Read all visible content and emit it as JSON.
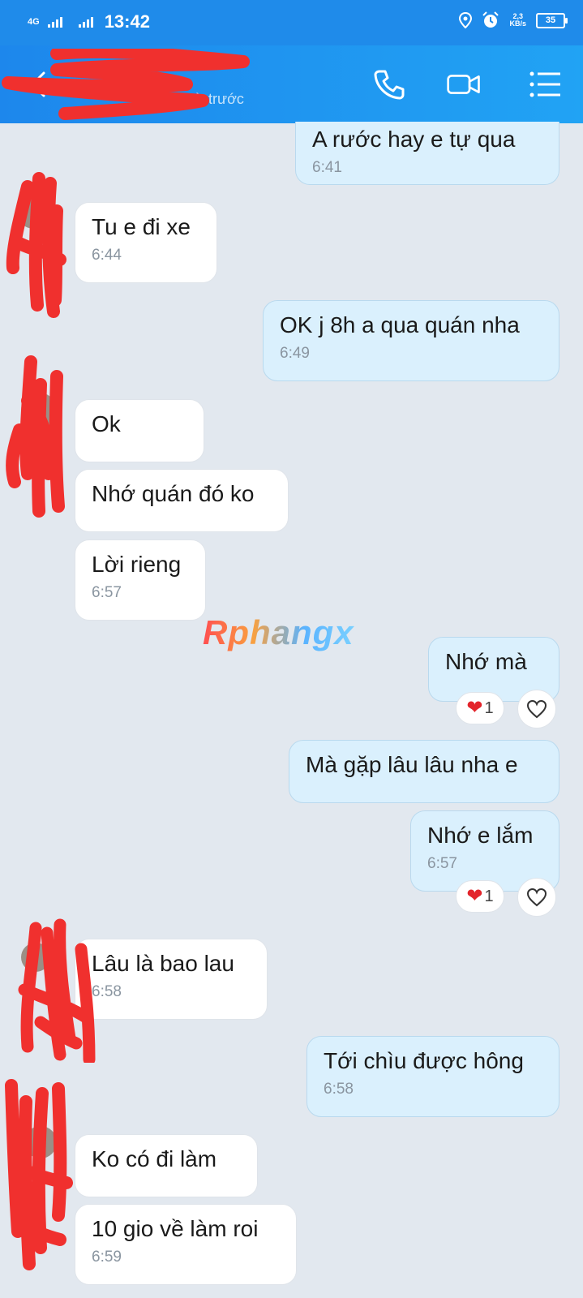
{
  "status_bar": {
    "network": "4G",
    "time": "13:42",
    "speed_value": "2,3",
    "speed_unit": "KB/s",
    "battery": "35"
  },
  "header": {
    "contact_name": "",
    "last_seen": "ừ trước"
  },
  "watermark": "Rphangx",
  "messages": [
    {
      "dir": "out",
      "text": "A rước hay e tự qua",
      "time": "6:41"
    },
    {
      "dir": "in",
      "text": "Tu e đi xe",
      "time": "6:44"
    },
    {
      "dir": "out",
      "text": "OK j 8h a qua quán nha",
      "time": "6:49"
    },
    {
      "dir": "in",
      "text": "Ok",
      "time": ""
    },
    {
      "dir": "in",
      "text": "Nhớ quán đó ko",
      "time": ""
    },
    {
      "dir": "in",
      "text": "Lời rieng",
      "time": "6:57"
    },
    {
      "dir": "out",
      "text": "Nhớ mà",
      "time": "",
      "reaction_count": "1"
    },
    {
      "dir": "out",
      "text": "Mà gặp lâu lâu nha e",
      "time": ""
    },
    {
      "dir": "out",
      "text": "Nhớ e lắm",
      "time": "6:57",
      "reaction_count": "1"
    },
    {
      "dir": "in",
      "text": "Lâu là bao lau",
      "time": "6:58"
    },
    {
      "dir": "out",
      "text": "Tới chìu được hông",
      "time": "6:58"
    },
    {
      "dir": "in",
      "text": "Ko có đi làm",
      "time": ""
    },
    {
      "dir": "in",
      "text": "10 gio về làm roi",
      "time": "6:59"
    }
  ],
  "colors": {
    "header": "#1f8bea",
    "out_bubble": "#daf0fd",
    "in_bubble": "#ffffff",
    "background": "#e2e8ef",
    "redaction": "#f0302e",
    "heart": "#e3242b"
  }
}
